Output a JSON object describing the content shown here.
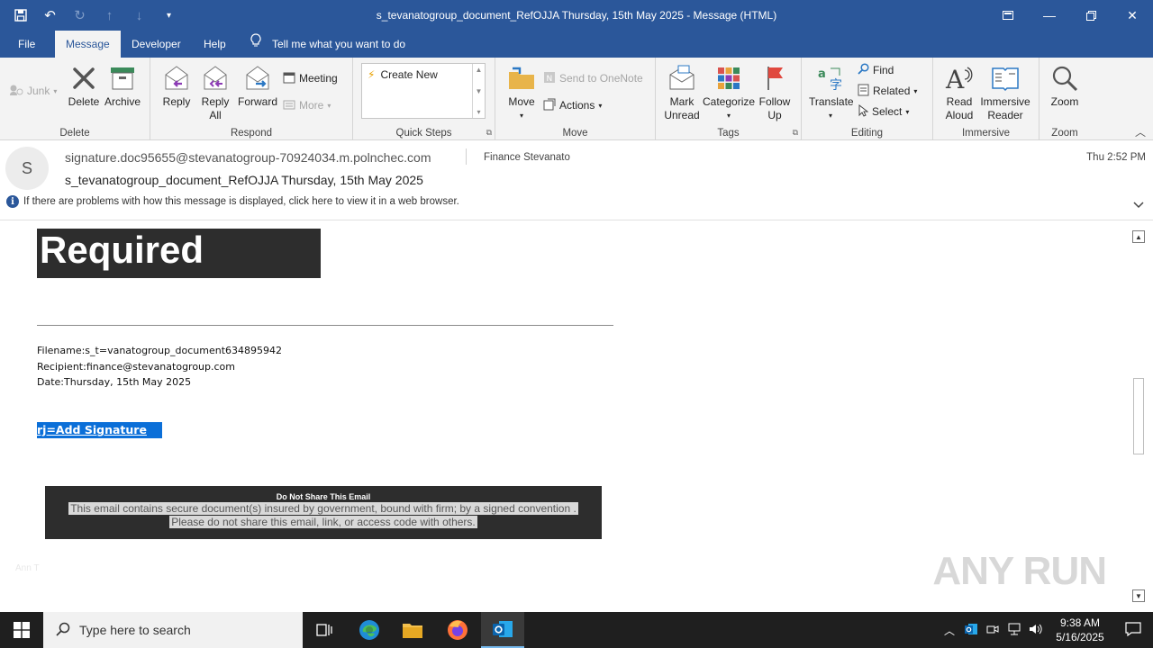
{
  "window": {
    "title": "s_tevanatogroup_document_RefOJJA Thursday, 15th May 2025  -  Message (HTML)"
  },
  "menu": {
    "tabs": [
      "File",
      "Message",
      "Developer",
      "Help"
    ],
    "tell_me": "Tell me what you want to do"
  },
  "ribbon": {
    "junk": "Junk",
    "delete_group": {
      "delete": "Delete",
      "archive": "Archive",
      "label": "Delete"
    },
    "respond_group": {
      "reply": "Reply",
      "reply_all_1": "Reply",
      "reply_all_2": "All",
      "forward": "Forward",
      "meeting": "Meeting",
      "more": "More",
      "label": "Respond"
    },
    "quick_steps": {
      "create_new": "Create New",
      "label": "Quick Steps"
    },
    "move_group": {
      "move": "Move",
      "onenote": "Send to OneNote",
      "actions": "Actions",
      "label": "Move"
    },
    "tags_group": {
      "mark_1": "Mark",
      "mark_2": "Unread",
      "categorize": "Categorize",
      "follow_1": "Follow",
      "follow_2": "Up",
      "label": "Tags"
    },
    "editing_group": {
      "translate": "Translate",
      "find": "Find",
      "related": "Related",
      "select": "Select",
      "label": "Editing"
    },
    "immersive_group": {
      "read_1": "Read",
      "read_2": "Aloud",
      "imm_1": "Immersive",
      "imm_2": "Reader",
      "label": "Immersive"
    },
    "zoom_group": {
      "zoom": "Zoom",
      "label": "Zoom"
    }
  },
  "message": {
    "avatar_initial": "S",
    "sender": "signature.doc95655@stevanatogroup-70924034.m.polnchec.com",
    "to": "Finance Stevanato",
    "time": "Thu 2:52 PM",
    "subject": "s_tevanatogroup_document_RefOJJA Thursday, 15th May 2025",
    "info_bar": "If there are problems with how this message is displayed, click here to view it in a web browser."
  },
  "body": {
    "banner": "Required",
    "filename": "Filename:s_t=vanatogroup_document634895942",
    "recipient": "Recipient:finance@stevanatogroup.com",
    "date": "Date:Thursday, 15th May 2025",
    "signature_link": "rj=Add Signature",
    "notice_title": "Do Not Share This Email",
    "notice_line1": "This email contains secure document(s) insured by government, bound with firm; by a signed convention .",
    "notice_line2": "Please do not share this email, link, or access code with others.",
    "faint_text": "Ann T",
    "watermark": "ANY RUN"
  },
  "taskbar": {
    "search_placeholder": "Type here to search",
    "time": "9:38 AM",
    "date": "5/16/2025"
  },
  "colors": {
    "accent": "#2b579a",
    "taskbar": "#1f1f1f",
    "banner": "#2d2d2d",
    "link_highlight": "#0b6fd8"
  }
}
